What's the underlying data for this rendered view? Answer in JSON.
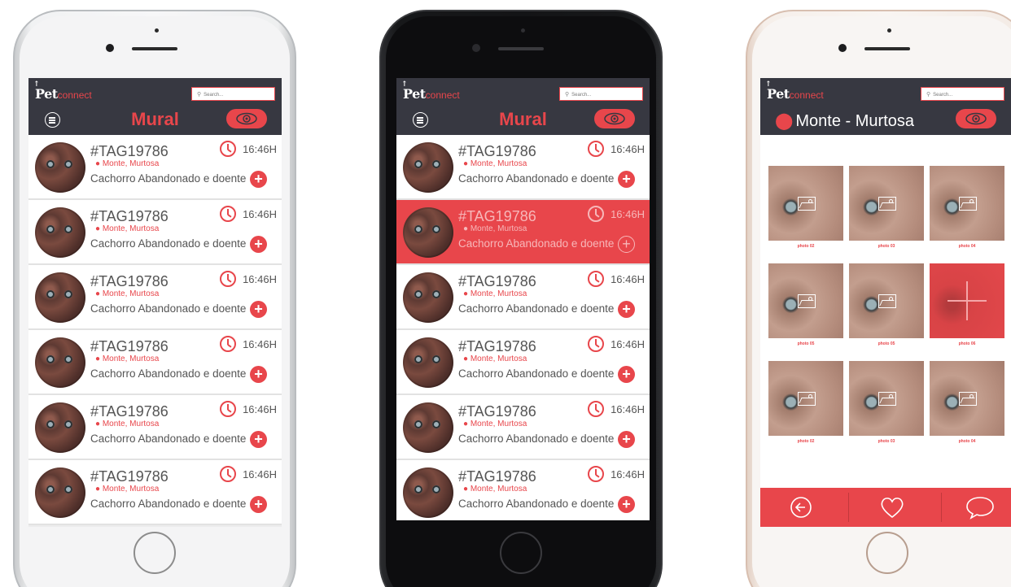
{
  "brand": {
    "logo_main": "Pet",
    "logo_sub": "connect"
  },
  "search": {
    "placeholder": "Search..."
  },
  "mural": {
    "title": "Mural"
  },
  "post": {
    "tag": "#TAG19786",
    "location": "Monte, Murtosa",
    "description": "Cachorro Abandonado e doente",
    "time": "16:46H"
  },
  "gallery": {
    "title": "Monte - Murtosa",
    "captions": [
      "photo 02",
      "photo 03",
      "photo 04",
      "photo 05",
      "photo 05",
      "photo 06",
      "photo 02",
      "photo 03",
      "photo 04"
    ]
  },
  "icons": {
    "menu": "menu-icon",
    "eye": "eye-icon",
    "clock": "clock-icon",
    "plus": "plus-icon",
    "pin": "location-pin-icon",
    "back": "back-arrow-icon",
    "heart": "heart-icon",
    "comment": "comment-icon"
  },
  "colors": {
    "accent": "#e8464b",
    "header": "#373841"
  }
}
